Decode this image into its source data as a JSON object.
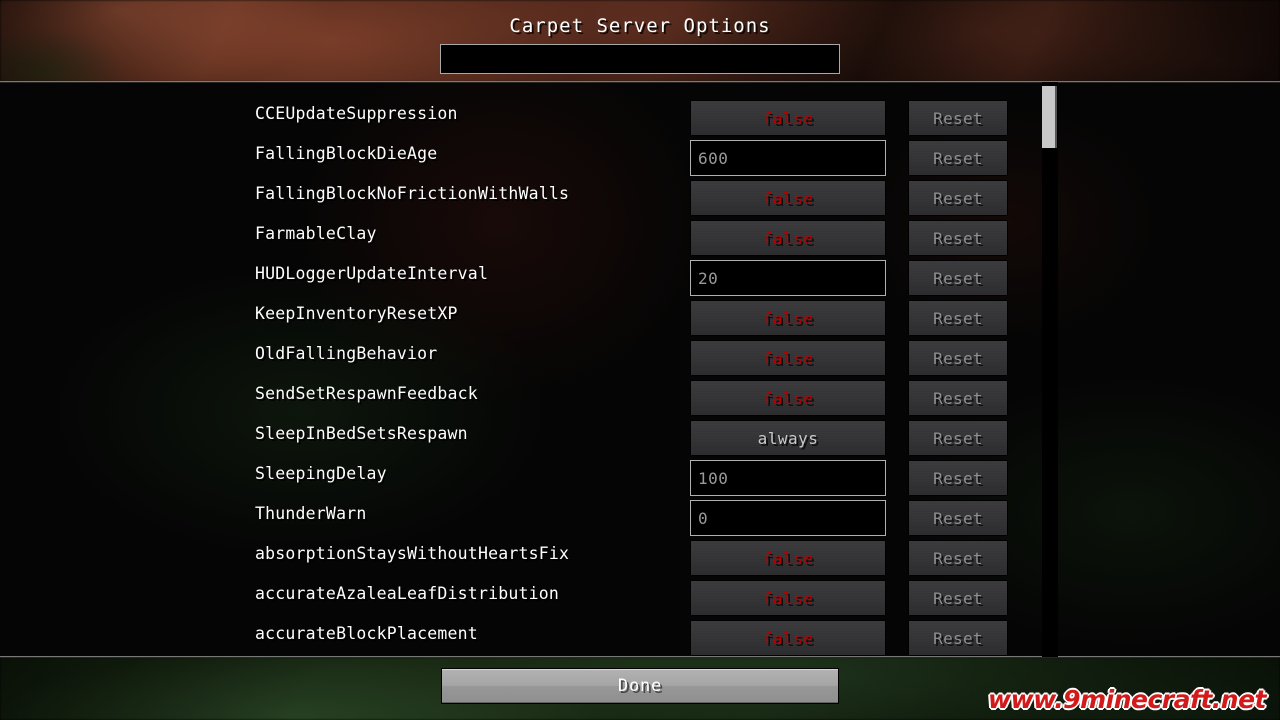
{
  "screen": {
    "title": "Carpet Server Options"
  },
  "search": {
    "value": "",
    "placeholder": ""
  },
  "scrollbar": {
    "thumb_label": "scroll-thumb"
  },
  "options": [
    {
      "label": "CCEUpdateSuppression",
      "type": "button",
      "value": "false",
      "reset": "Reset"
    },
    {
      "label": "FallingBlockDieAge",
      "type": "input",
      "value": "600",
      "reset": "Reset"
    },
    {
      "label": "FallingBlockNoFrictionWithWalls",
      "type": "button",
      "value": "false",
      "reset": "Reset"
    },
    {
      "label": "FarmableClay",
      "type": "button",
      "value": "false",
      "reset": "Reset"
    },
    {
      "label": "HUDLoggerUpdateInterval",
      "type": "input",
      "value": "20",
      "reset": "Reset"
    },
    {
      "label": "KeepInventoryResetXP",
      "type": "button",
      "value": "false",
      "reset": "Reset"
    },
    {
      "label": "OldFallingBehavior",
      "type": "button",
      "value": "false",
      "reset": "Reset"
    },
    {
      "label": "SendSetRespawnFeedback",
      "type": "button",
      "value": "false",
      "reset": "Reset"
    },
    {
      "label": "SleepInBedSetsRespawn",
      "type": "button",
      "value": "always",
      "reset": "Reset",
      "neutral": true
    },
    {
      "label": "SleepingDelay",
      "type": "input",
      "value": "100",
      "reset": "Reset"
    },
    {
      "label": "ThunderWarn",
      "type": "input",
      "value": "0",
      "reset": "Reset"
    },
    {
      "label": "absorptionStaysWithoutHeartsFix",
      "type": "button",
      "value": "false",
      "reset": "Reset"
    },
    {
      "label": "accurateAzaleaLeafDistribution",
      "type": "button",
      "value": "false",
      "reset": "Reset"
    },
    {
      "label": "accurateBlockPlacement",
      "type": "button",
      "value": "false",
      "reset": "Reset"
    }
  ],
  "footer": {
    "done_label": "Done"
  },
  "watermark": {
    "text": "www.9minecraft.net"
  },
  "colors": {
    "value_false": "#bb0000",
    "value_neutral": "#c9c9c9",
    "label_text": "#ffffff",
    "reset_text": "#8f8f8f",
    "button_face": "#343436",
    "input_bg": "#000000",
    "watermark": "#d31a1a"
  }
}
